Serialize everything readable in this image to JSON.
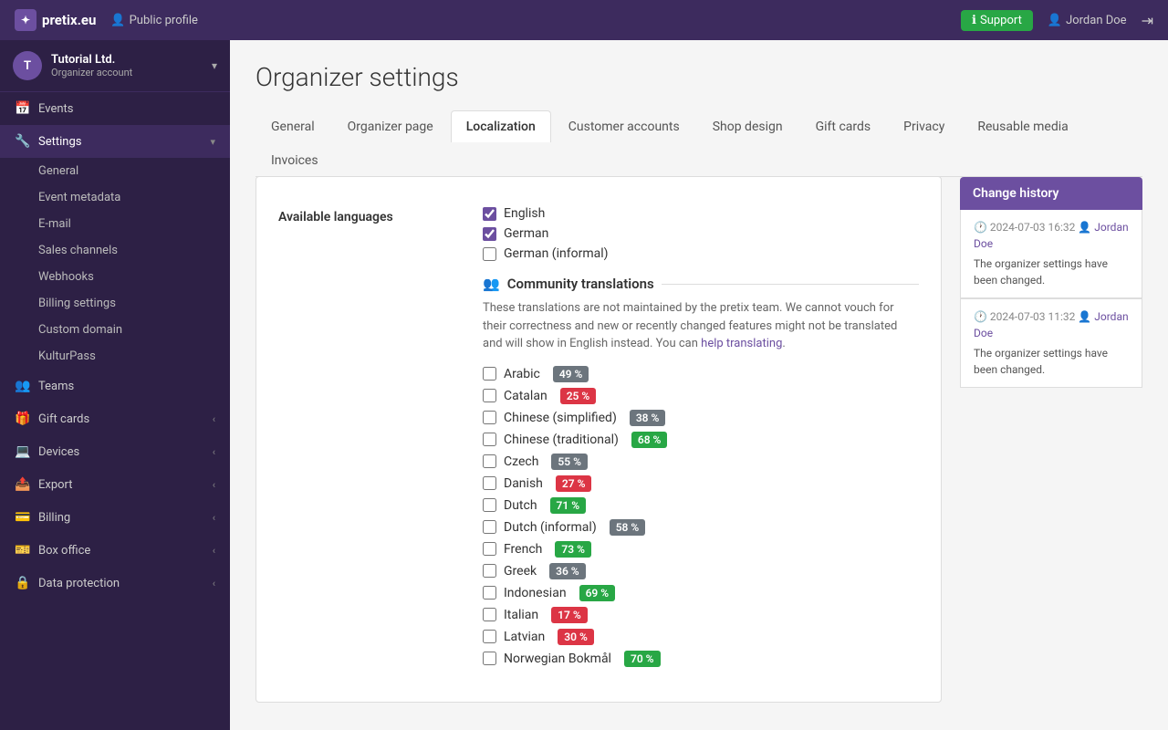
{
  "topnav": {
    "logo": "pretix.eu",
    "public_profile_label": "Public profile",
    "support_label": "Support",
    "user_label": "Jordan Doe"
  },
  "sidebar": {
    "org_name": "Tutorial Ltd.",
    "org_sub": "Organizer account",
    "org_initials": "T",
    "items": [
      {
        "id": "events",
        "label": "Events",
        "icon": "📅",
        "has_sub": false
      },
      {
        "id": "settings",
        "label": "Settings",
        "icon": "🔧",
        "has_sub": true,
        "expanded": true
      },
      {
        "id": "general",
        "label": "General",
        "sub": true
      },
      {
        "id": "event-metadata",
        "label": "Event metadata",
        "sub": true
      },
      {
        "id": "e-mail",
        "label": "E-mail",
        "sub": true
      },
      {
        "id": "sales-channels",
        "label": "Sales channels",
        "sub": true
      },
      {
        "id": "webhooks",
        "label": "Webhooks",
        "sub": true
      },
      {
        "id": "billing-settings",
        "label": "Billing settings",
        "sub": true
      },
      {
        "id": "custom-domain",
        "label": "Custom domain",
        "sub": true
      },
      {
        "id": "kulturpass",
        "label": "KulturPass",
        "sub": true
      },
      {
        "id": "teams",
        "label": "Teams",
        "icon": "👥",
        "has_sub": false
      },
      {
        "id": "gift-cards",
        "label": "Gift cards",
        "icon": "🎁",
        "has_sub": true
      },
      {
        "id": "devices",
        "label": "Devices",
        "icon": "💻",
        "has_sub": true
      },
      {
        "id": "export",
        "label": "Export",
        "icon": "📤",
        "has_sub": true
      },
      {
        "id": "billing",
        "label": "Billing",
        "icon": "💳",
        "has_sub": true
      },
      {
        "id": "box-office",
        "label": "Box office",
        "icon": "🎫",
        "has_sub": true
      },
      {
        "id": "data-protection",
        "label": "Data protection",
        "icon": "🔒",
        "has_sub": true
      }
    ]
  },
  "page": {
    "title": "Organizer settings",
    "tabs": [
      {
        "id": "general",
        "label": "General"
      },
      {
        "id": "organizer-page",
        "label": "Organizer page"
      },
      {
        "id": "localization",
        "label": "Localization",
        "active": true
      },
      {
        "id": "customer-accounts",
        "label": "Customer accounts"
      },
      {
        "id": "shop-design",
        "label": "Shop design"
      },
      {
        "id": "gift-cards",
        "label": "Gift cards"
      },
      {
        "id": "privacy",
        "label": "Privacy"
      },
      {
        "id": "reusable-media",
        "label": "Reusable media"
      },
      {
        "id": "invoices",
        "label": "Invoices"
      }
    ]
  },
  "localization": {
    "available_languages_label": "Available languages",
    "languages": [
      {
        "id": "en",
        "label": "English",
        "checked": true
      },
      {
        "id": "de",
        "label": "German",
        "checked": true
      },
      {
        "id": "de-informal",
        "label": "German (informal)",
        "checked": false
      }
    ],
    "community_section_label": "Community translations",
    "community_notice": "These translations are not maintained by the pretix team. We cannot vouch for their correctness and new or recently changed features might not be translated and will show in English instead. You can",
    "community_notice_link_text": "help translating",
    "community_notice_end": ".",
    "community_languages": [
      {
        "id": "ar",
        "label": "Arabic",
        "pct": "49 %",
        "level": "mid"
      },
      {
        "id": "ca",
        "label": "Catalan",
        "pct": "25 %",
        "level": "low"
      },
      {
        "id": "zh-hans",
        "label": "Chinese (simplified)",
        "pct": "38 %",
        "level": "mid"
      },
      {
        "id": "zh-hant",
        "label": "Chinese (traditional)",
        "pct": "68 %",
        "level": "high"
      },
      {
        "id": "cs",
        "label": "Czech",
        "pct": "55 %",
        "level": "mid"
      },
      {
        "id": "da",
        "label": "Danish",
        "pct": "27 %",
        "level": "low"
      },
      {
        "id": "nl",
        "label": "Dutch",
        "pct": "71 %",
        "level": "high"
      },
      {
        "id": "nl-informal",
        "label": "Dutch (informal)",
        "pct": "58 %",
        "level": "mid"
      },
      {
        "id": "fr",
        "label": "French",
        "pct": "73 %",
        "level": "high"
      },
      {
        "id": "el",
        "label": "Greek",
        "pct": "36 %",
        "level": "mid"
      },
      {
        "id": "id",
        "label": "Indonesian",
        "pct": "69 %",
        "level": "high"
      },
      {
        "id": "it",
        "label": "Italian",
        "pct": "17 %",
        "level": "low"
      },
      {
        "id": "lv",
        "label": "Latvian",
        "pct": "30 %",
        "level": "low"
      },
      {
        "id": "nb",
        "label": "Norwegian Bokmål",
        "pct": "70 %",
        "level": "high"
      }
    ]
  },
  "history": {
    "title": "Change history",
    "entries": [
      {
        "date": "2024-07-03",
        "time": "16:32",
        "user": "Jordan Doe",
        "message": "The organizer settings have been changed."
      },
      {
        "date": "2024-07-03",
        "time": "11:32",
        "user": "Jordan Doe",
        "message": "The organizer settings have been changed."
      }
    ]
  }
}
